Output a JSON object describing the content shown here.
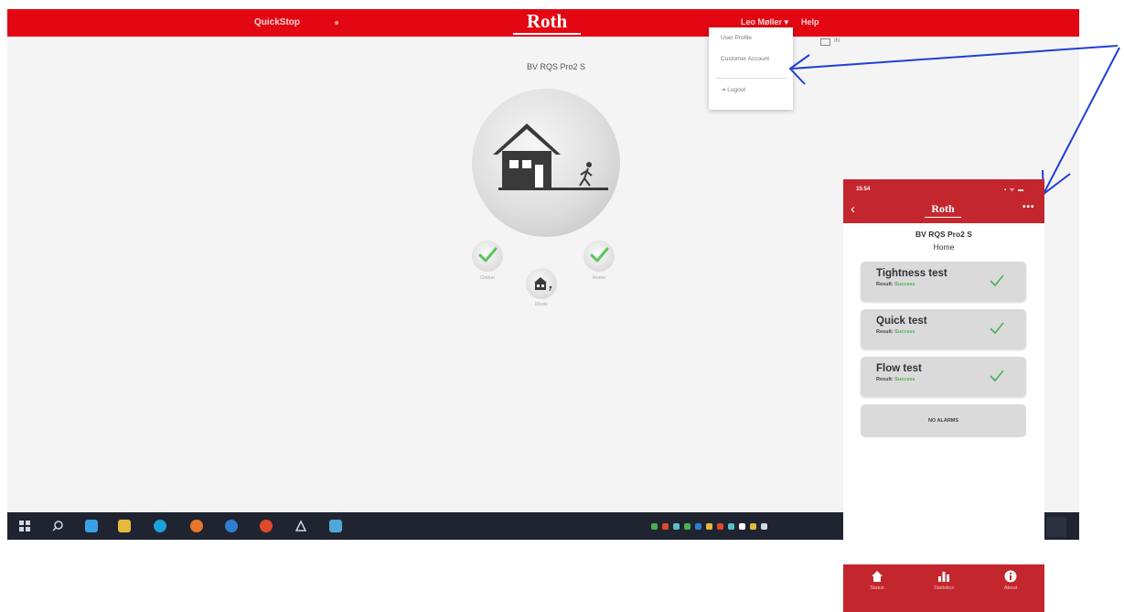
{
  "desktop": {
    "topbar": {
      "app_name": "QuickStop",
      "brand": "Roth",
      "user_menu": "Leo Møller ▾",
      "help": "Help"
    },
    "dropdown": {
      "items": [
        "User Profile",
        "Customer Account",
        "⇥ Logout"
      ]
    },
    "screen_label": "IN",
    "device_title": "BV RQS Pro2 S",
    "modes": {
      "left_label": "Online",
      "right_label": "Home",
      "center_label": "Mode"
    },
    "colors": {
      "brand_red": "#e30613",
      "check_green": "#5cc55c"
    }
  },
  "phone": {
    "time": "15:54",
    "status_icons": "▪ ᯤ ▬",
    "back": "‹",
    "brand": "Roth",
    "more": "•••",
    "device_title": "BV RQS Pro2 S",
    "subtitle": "Home",
    "tests": [
      {
        "title": "Tightness test",
        "result_label": "Result:",
        "result_value": "Success"
      },
      {
        "title": "Quick test",
        "result_label": "Result:",
        "result_value": "Success"
      },
      {
        "title": "Flow test",
        "result_label": "Result:",
        "result_value": "Success"
      }
    ],
    "alarms": "NO ALARMS",
    "nav": [
      {
        "label": "Status",
        "icon": "home-icon"
      },
      {
        "label": "Statistics",
        "icon": "bar-chart-icon"
      },
      {
        "label": "About",
        "icon": "info-icon"
      }
    ],
    "colors": {
      "header_red": "#c4262e",
      "success_green": "#4caf50"
    }
  }
}
